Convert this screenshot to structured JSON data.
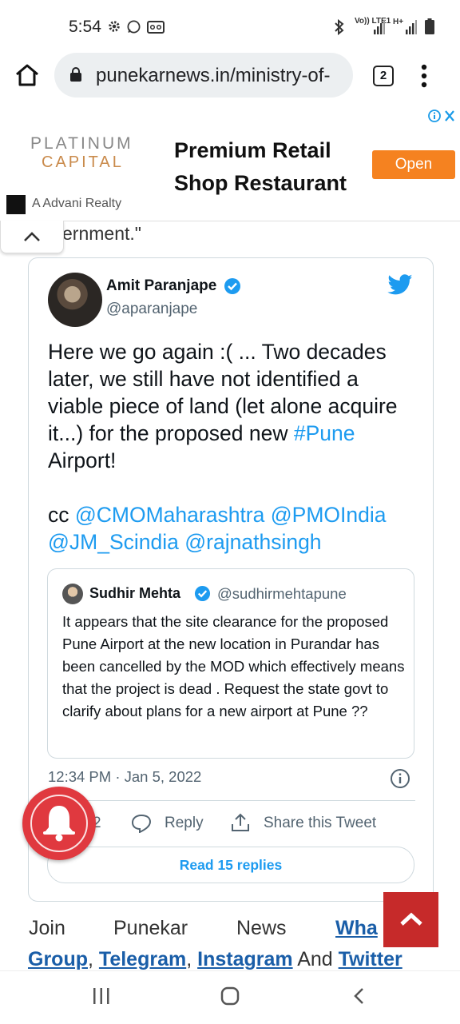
{
  "status_bar": {
    "time": "5:54",
    "left_icons": [
      "gear-icon",
      "whatsapp-icon",
      "voicemail-icon"
    ],
    "right_icons": [
      "bluetooth-icon",
      "volte-icon",
      "signal-icon",
      "hplus-icon",
      "signal-icon",
      "battery-icon"
    ],
    "volte_label": "Vo)) LTE1",
    "hplus_label": "H+"
  },
  "browser": {
    "url": "punekarnews.in/ministry-of-",
    "tab_count": "2"
  },
  "ad": {
    "logo_line1": "PLATINUM",
    "logo_line2": "CAPITAL",
    "headline": "Premium Retail Shop Restaurant",
    "cta": "Open",
    "sponsor": "A Advani Realty",
    "logo_color": "#c98a4b",
    "cta_color": "#f58220"
  },
  "article": {
    "partial_text": "ernment.\""
  },
  "tweet": {
    "name": "Amit Paranjape",
    "handle": "@aparanjape",
    "text_pre": "Here we go again :( ... Two decades later, we still have not identified a viable piece of land (let alone acquire it...) for the proposed new ",
    "hashtag": "#Pune",
    "text_post": " Airport!",
    "cc_label": "cc ",
    "mention1": "@CMOMaharashtra",
    "mention2": "@PMOIndia",
    "mention3": "@JM_Scindia",
    "mention4": "@rajnathsingh",
    "quote": {
      "name": "Sudhir Mehta",
      "handle": "@sudhirmehtapune",
      "text": "It appears that the site clearance for the proposed Pune Airport  at the  new  location in Purandar has been cancelled by the MOD which effectively means that the project is dead . Request the state govt to clarify about plans for a new airport at Pune ??"
    },
    "timestamp": "12:34 PM · Jan 5, 2022",
    "like_count": "2",
    "reply_label": "Reply",
    "share_label": "Share this Tweet",
    "read_replies": "Read 15 replies",
    "accent": "#1d9bf0"
  },
  "join": {
    "w1": "Join",
    "w2": "Punekar",
    "w3": "News",
    "link1": "Wha",
    "link2": "Group",
    "link3": "Telegram",
    "link4": "Instagram",
    "and": "And",
    "link5": "Twitter"
  }
}
